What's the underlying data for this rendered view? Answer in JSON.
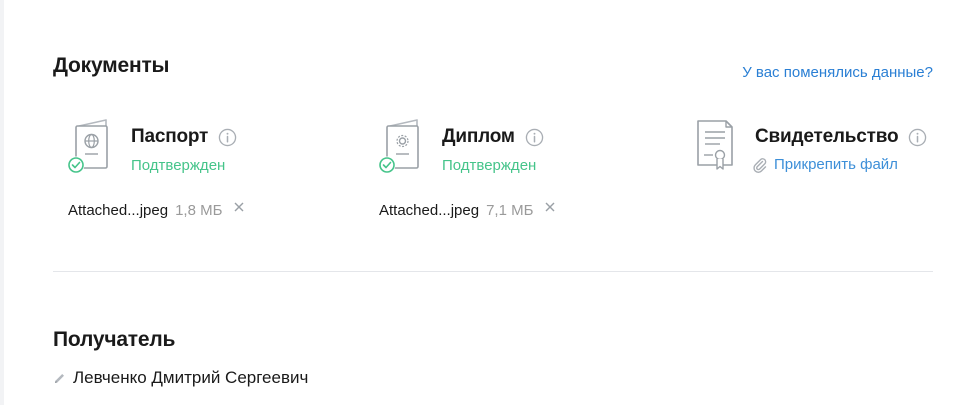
{
  "documents": {
    "title": "Документы",
    "changed_link": "У вас поменялись данные?",
    "items": [
      {
        "name": "Паспорт",
        "status": "Подтвержден",
        "file_name": "Attached...jpeg",
        "file_size": "1,8 МБ",
        "icon": "passport-icon"
      },
      {
        "name": "Диплом",
        "status": "Подтвержден",
        "file_name": "Attached...jpeg",
        "file_size": "7,1 МБ",
        "icon": "diploma-icon"
      },
      {
        "name": "Свидетельство",
        "attach_label": "Прикрепить файл",
        "icon": "certificate-icon"
      }
    ]
  },
  "recipient": {
    "title": "Получатель",
    "name": "Левченко Дмитрий Сергеевич"
  },
  "colors": {
    "link": "#2a7fd4",
    "confirmed": "#45c48a",
    "muted": "#9a9a9a",
    "icon": "#9aa0a6"
  }
}
